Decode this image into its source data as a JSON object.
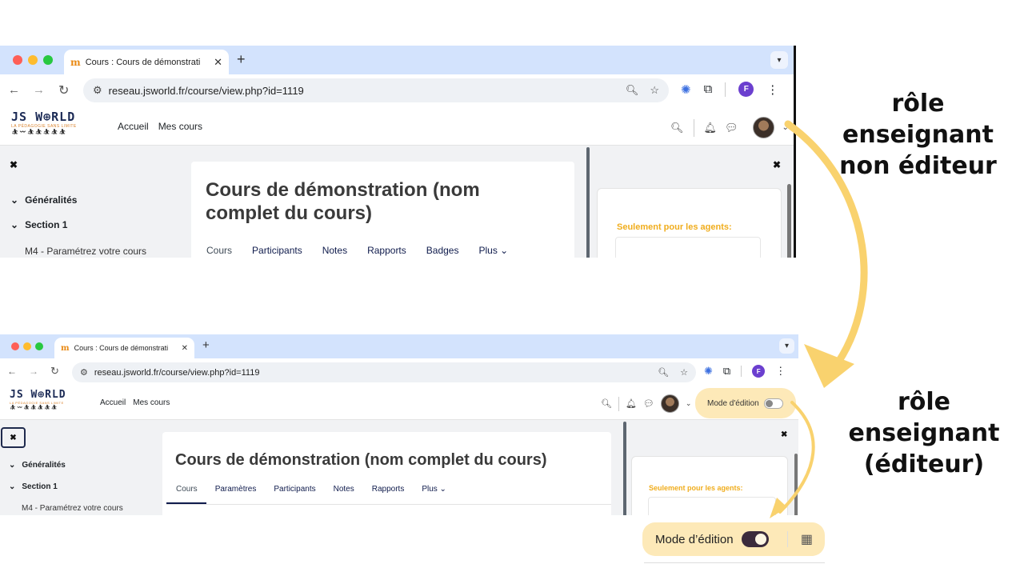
{
  "browser": {
    "tab_title": "Cours : Cours de démonstrati",
    "tab_close": "✕",
    "new_tab": "+",
    "url": "reseau.jsworld.fr/course/view.php?id=1119",
    "profile_initial": "F"
  },
  "site": {
    "logo_main": "JS W⊕RLD",
    "logo_tagline": "LA PÉDAGOGIE SANS LIMITE",
    "logo_figures": "⛹︎〰︎⛹︎⛹︎⛹︎⛹︎⛹︎",
    "nav_home": "Accueil",
    "nav_courses": "Mes cours"
  },
  "course": {
    "title": "Cours de démonstration (nom complet du cours)",
    "left_close": "✖",
    "right_close": "✖",
    "sections": [
      "Généralités",
      "Section 1"
    ],
    "activity": "M4 - Paramétrez votre cours",
    "agents_label": "Seulement pour les agents:"
  },
  "top_view": {
    "tabs": [
      "Cours",
      "Participants",
      "Notes",
      "Rapports",
      "Badges",
      "Plus"
    ],
    "active_tab": "Cours",
    "role_label": "rôle enseignant non éditeur"
  },
  "bottom_view": {
    "tabs": [
      "Cours",
      "Paramètres",
      "Participants",
      "Notes",
      "Rapports",
      "Plus"
    ],
    "active_tab": "Cours",
    "edit_mode_label": "Mode d'édition",
    "role_label": "rôle enseignant (éditeur)"
  },
  "zoom_callout": {
    "edit_mode_label": "Mode d’édition",
    "edit_mode_on": true
  },
  "colors": {
    "arrow": "#f9d26e",
    "pill": "#fde9b8",
    "agents": "#f0ad1d",
    "toggle_on": "#3b2b3c",
    "browser_chrome": "#d3e3fd"
  }
}
